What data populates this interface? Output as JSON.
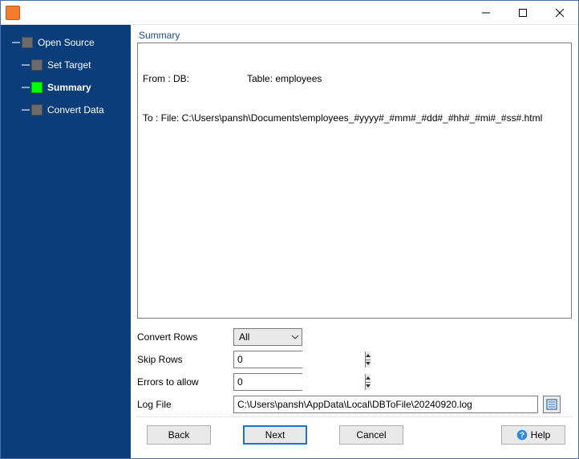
{
  "sidebar": {
    "items": [
      {
        "label": "Open Source"
      },
      {
        "label": "Set Target"
      },
      {
        "label": "Summary"
      },
      {
        "label": "Convert Data"
      }
    ]
  },
  "main": {
    "section_title": "Summary",
    "summary": {
      "from_label": "From : DB:",
      "table_label": "Table: employees",
      "to_line": "To : File: C:\\Users\\pansh\\Documents\\employees_#yyyy#_#mm#_#dd#_#hh#_#mi#_#ss#.html"
    },
    "form": {
      "convert_rows": {
        "label": "Convert Rows",
        "value": "All"
      },
      "skip_rows": {
        "label": "Skip Rows",
        "value": "0"
      },
      "errors_allow": {
        "label": "Errors to allow",
        "value": "0"
      },
      "log_file": {
        "label": "Log File",
        "value": "C:\\Users\\pansh\\AppData\\Local\\DBToFile\\20240920.log"
      }
    }
  },
  "footer": {
    "back": "Back",
    "next": "Next",
    "cancel": "Cancel",
    "help": "Help"
  }
}
